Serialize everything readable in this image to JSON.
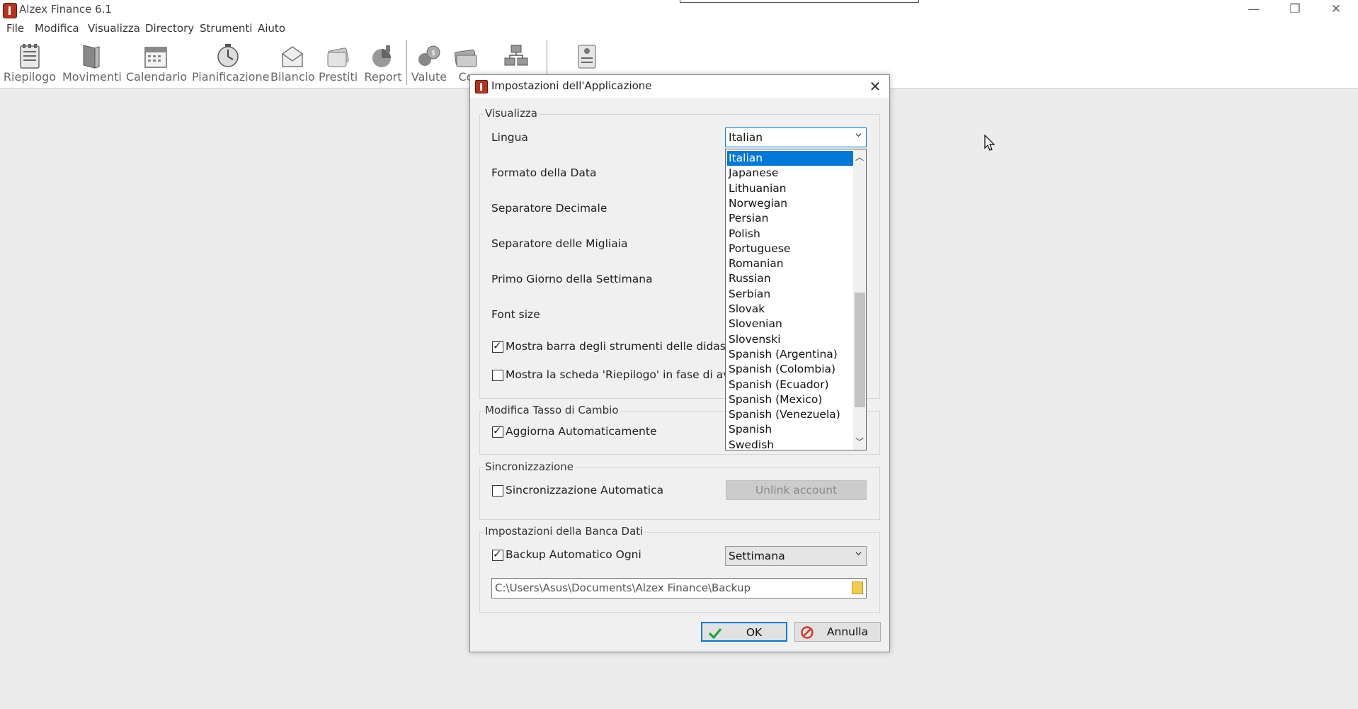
{
  "window": {
    "title": "Alzex Finance 6.1",
    "controls": {
      "minimize": "—",
      "restore": "❐",
      "close": "✕"
    }
  },
  "menu": [
    "File",
    "Modifica",
    "Visualizza",
    "Directory",
    "Strumenti",
    "Aiuto"
  ],
  "toolbar": [
    {
      "label": "Riepilogo",
      "icon": "summary-icon"
    },
    {
      "label": "Movimenti",
      "icon": "transactions-icon"
    },
    {
      "label": "Calendario",
      "icon": "calendar-icon"
    },
    {
      "label": "Pianificazione",
      "icon": "planning-icon"
    },
    {
      "label": "Bilancio",
      "icon": "budget-icon"
    },
    {
      "label": "Prestiti",
      "icon": "loans-icon"
    },
    {
      "label": "Report",
      "icon": "report-icon"
    },
    {
      "label": "Valute",
      "icon": "currencies-icon"
    },
    {
      "label": "Co",
      "icon": "accounts-icon"
    },
    {
      "label": "",
      "icon": "categories-icon"
    },
    {
      "label": "",
      "icon": "settings-icon"
    }
  ],
  "dialog": {
    "title": "Impostazioni dell'Applicazione",
    "close": "✕",
    "visualizza": {
      "title": "Visualizza",
      "lingua_label": "Lingua",
      "lingua_value": "Italian",
      "formato_data_label": "Formato della Data",
      "separatore_decimale_label": "Separatore Decimale",
      "separatore_migliaia_label": "Separatore delle Migliaia",
      "primo_giorno_label": "Primo Giorno della Settimana",
      "font_size_label": "Font size",
      "mostra_barra_label": "Mostra barra degli strumenti delle didasca",
      "mostra_barra_checked": true,
      "mostra_scheda_label": "Mostra la scheda 'Riepilogo' in fase di avv",
      "mostra_scheda_checked": false
    },
    "tasso": {
      "title": "Modifica Tasso di Cambio",
      "aggiorna_label": "Aggiorna Automaticamente",
      "aggiorna_checked": true
    },
    "sync": {
      "title": "Sincronizzazione",
      "auto_label": "Sincronizzazione Automatica",
      "auto_checked": false,
      "unlink_label": "Unlink account"
    },
    "banca": {
      "title": "Impostazioni della Banca Dati",
      "backup_label": "Backup Automatico Ogni",
      "backup_checked": true,
      "backup_value": "Settimana",
      "path": "C:\\Users\\Asus\\Documents\\Alzex Finance\\Backup"
    },
    "ok_label": "OK",
    "cancel_label": "Annulla"
  },
  "language_options": [
    "Italian",
    "Japanese",
    "Lithuanian",
    "Norwegian",
    "Persian",
    "Polish",
    "Portuguese",
    "Romanian",
    "Russian",
    "Serbian",
    "Slovak",
    "Slovenian",
    "Slovenski",
    "Spanish (Argentina)",
    "Spanish (Colombia)",
    "Spanish (Ecuador)",
    "Spanish (Mexico)",
    "Spanish (Venezuela)",
    "Spanish",
    "Swedish"
  ],
  "selected_language_index": 0,
  "colors": {
    "accent": "#0078d7",
    "brand": "#b8331e"
  }
}
